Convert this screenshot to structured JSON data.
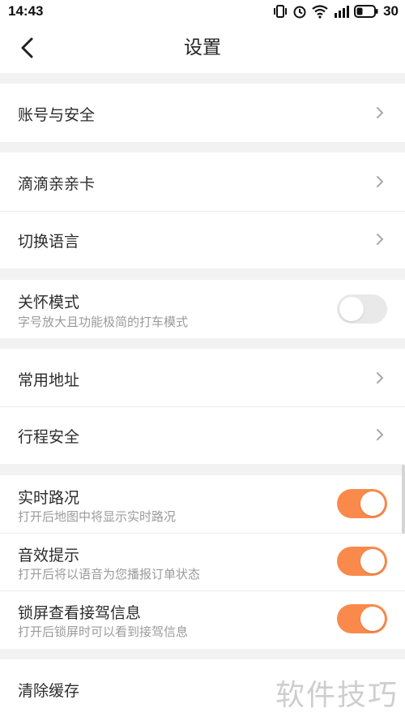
{
  "status_bar": {
    "time": "14:43",
    "battery": "30"
  },
  "header": {
    "title": "设置"
  },
  "sections": {
    "account": {
      "label": "账号与安全"
    },
    "family_card": {
      "label": "滴滴亲亲卡"
    },
    "language": {
      "label": "切换语言"
    },
    "care_mode": {
      "label": "关怀模式",
      "sub": "字号放大且功能极简的打车模式",
      "enabled": false
    },
    "addresses": {
      "label": "常用地址"
    },
    "trip_safety": {
      "label": "行程安全"
    },
    "traffic": {
      "label": "实时路况",
      "sub": "打开后地图中将显示实时路况",
      "enabled": true
    },
    "sound": {
      "label": "音效提示",
      "sub": "打开后将以语音为您播报订单状态",
      "enabled": true
    },
    "lock_screen": {
      "label": "锁屏查看接驾信息",
      "sub": "打开后锁屏时可以看到接驾信息",
      "enabled": true
    },
    "clear_cache": {
      "label": "清除缓存"
    }
  },
  "watermark": "软件技巧",
  "colors": {
    "accent": "#fa8a4c",
    "toggle_off": "#e9e9e9"
  }
}
